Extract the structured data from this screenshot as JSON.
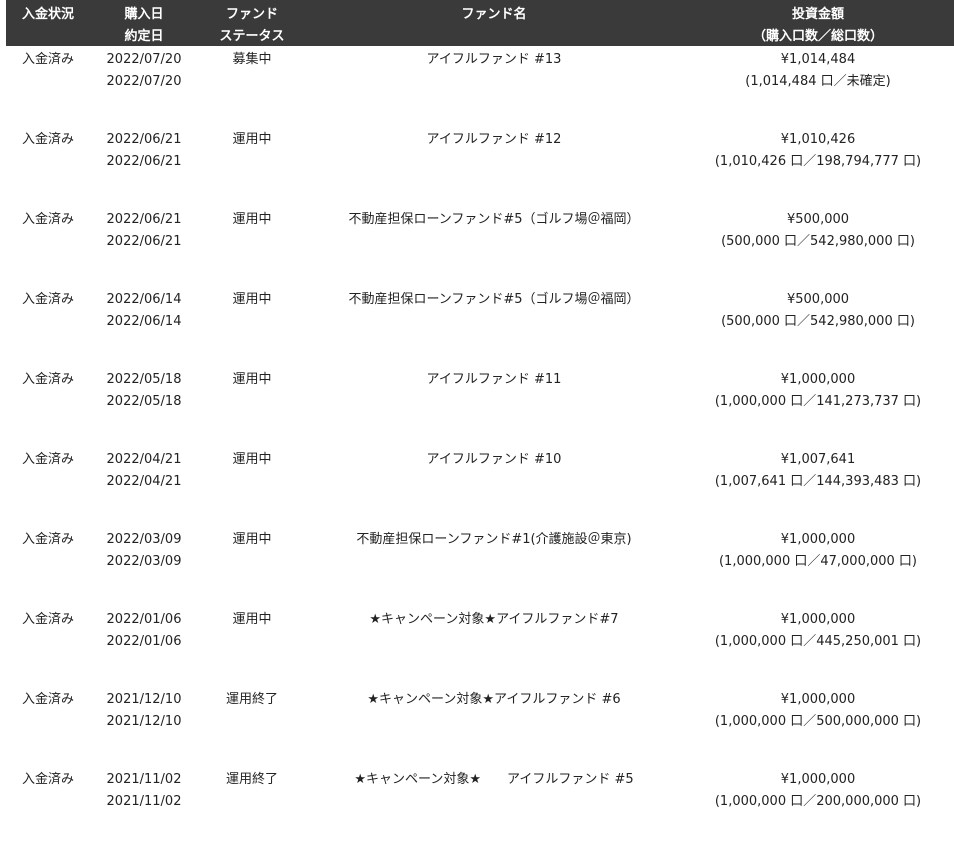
{
  "header": {
    "col1": "入金状況",
    "col2_line1": "購入日",
    "col2_line2": "約定日",
    "col3_line1": "ファンド",
    "col3_line2": "ステータス",
    "col4": "ファンド名",
    "col5_line1": "投資金額",
    "col5_line2": "（購入口数／総口数）"
  },
  "rows": [
    {
      "status": "入金済み",
      "purchase_date": "2022/07/20",
      "contract_date": "2022/07/20",
      "fund_status": "募集中",
      "fund_name": "アイフルファンド #13",
      "amount": "¥1,014,484",
      "units": "(1,014,484 口／未確定)"
    },
    {
      "status": "入金済み",
      "purchase_date": "2022/06/21",
      "contract_date": "2022/06/21",
      "fund_status": "運用中",
      "fund_name": "アイフルファンド #12",
      "amount": "¥1,010,426",
      "units": "(1,010,426 口／198,794,777 口)"
    },
    {
      "status": "入金済み",
      "purchase_date": "2022/06/21",
      "contract_date": "2022/06/21",
      "fund_status": "運用中",
      "fund_name": "不動産担保ローンファンド#5（ゴルフ場＠福岡）",
      "amount": "¥500,000",
      "units": "(500,000 口／542,980,000 口)"
    },
    {
      "status": "入金済み",
      "purchase_date": "2022/06/14",
      "contract_date": "2022/06/14",
      "fund_status": "運用中",
      "fund_name": "不動産担保ローンファンド#5（ゴルフ場＠福岡）",
      "amount": "¥500,000",
      "units": "(500,000 口／542,980,000 口)"
    },
    {
      "status": "入金済み",
      "purchase_date": "2022/05/18",
      "contract_date": "2022/05/18",
      "fund_status": "運用中",
      "fund_name": "アイフルファンド #11",
      "amount": "¥1,000,000",
      "units": "(1,000,000 口／141,273,737 口)"
    },
    {
      "status": "入金済み",
      "purchase_date": "2022/04/21",
      "contract_date": "2022/04/21",
      "fund_status": "運用中",
      "fund_name": "アイフルファンド #10",
      "amount": "¥1,007,641",
      "units": "(1,007,641 口／144,393,483 口)"
    },
    {
      "status": "入金済み",
      "purchase_date": "2022/03/09",
      "contract_date": "2022/03/09",
      "fund_status": "運用中",
      "fund_name": "不動産担保ローンファンド#1(介護施設＠東京)",
      "amount": "¥1,000,000",
      "units": "(1,000,000 口／47,000,000 口)"
    },
    {
      "status": "入金済み",
      "purchase_date": "2022/01/06",
      "contract_date": "2022/01/06",
      "fund_status": "運用中",
      "fund_name": "★キャンペーン対象★アイフルファンド#7",
      "amount": "¥1,000,000",
      "units": "(1,000,000 口／445,250,001 口)"
    },
    {
      "status": "入金済み",
      "purchase_date": "2021/12/10",
      "contract_date": "2021/12/10",
      "fund_status": "運用終了",
      "fund_name": "★キャンペーン対象★アイフルファンド #6",
      "amount": "¥1,000,000",
      "units": "(1,000,000 口／500,000,000 口)"
    },
    {
      "status": "入金済み",
      "purchase_date": "2021/11/02",
      "contract_date": "2021/11/02",
      "fund_status": "運用終了",
      "fund_name": "★キャンペーン対象★　　アイフルファンド #5",
      "amount": "¥1,000,000",
      "units": "(1,000,000 口／200,000,000 口)"
    }
  ]
}
